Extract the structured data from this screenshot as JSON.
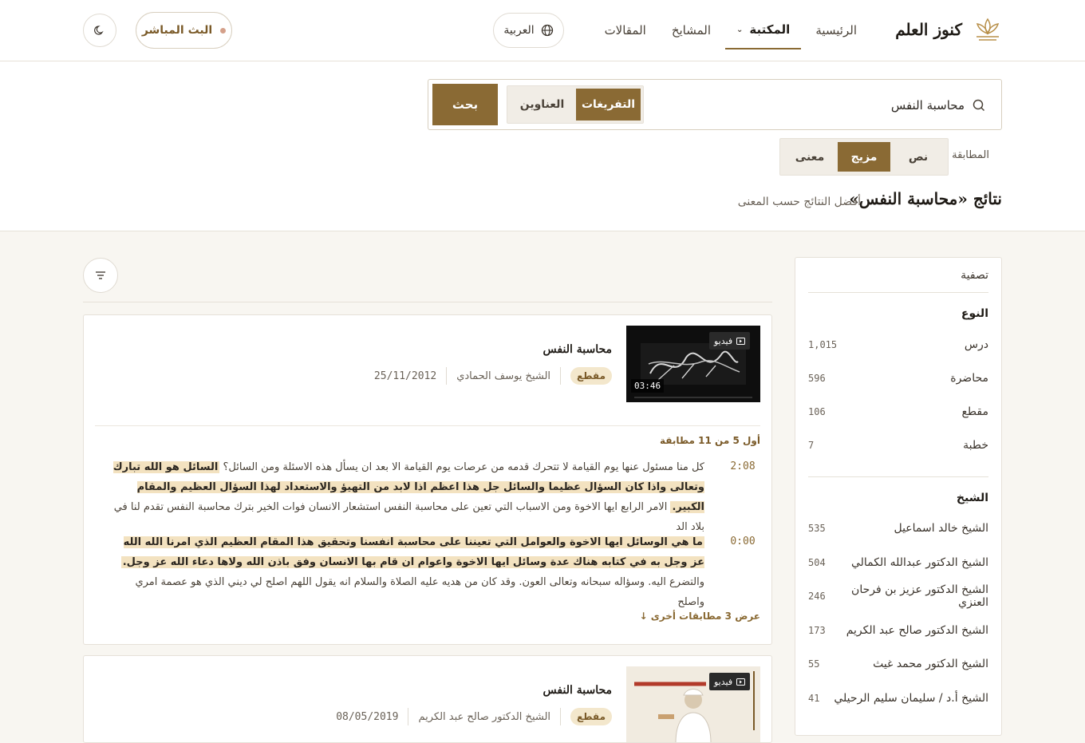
{
  "header": {
    "logo_text": "كنوز العلم",
    "nav": [
      {
        "label": "الرئيسية"
      },
      {
        "label": "المكتبة"
      },
      {
        "label": "المشايخ"
      },
      {
        "label": "المقالات"
      }
    ],
    "language": "العربية",
    "live": "البث المباشر"
  },
  "search": {
    "query": "محاسبة النفس",
    "scope_options": [
      "العناوين",
      "التفريغات"
    ],
    "scope_selected": "التفريغات",
    "button": "بحث",
    "match_label": "المطابقة",
    "match_options": [
      "نص",
      "مزيج",
      "معنى"
    ],
    "match_selected": "مزيج"
  },
  "results": {
    "title": "نتائج «محاسبة النفس»",
    "subtitle": "أفضل النتائج حسب المعنى"
  },
  "sidebar": {
    "title": "تصفية",
    "type_heading": "النوع",
    "types": [
      {
        "label": "درس",
        "count": "1,015"
      },
      {
        "label": "محاضرة",
        "count": "596"
      },
      {
        "label": "مقطع",
        "count": "106"
      },
      {
        "label": "خطبة",
        "count": "7"
      }
    ],
    "sheikh_heading": "الشيخ",
    "sheikhs": [
      {
        "label": "الشيخ خالد اسماعيل",
        "count": "535"
      },
      {
        "label": "الشيخ الدكتور عبدالله الكمالي",
        "count": "504"
      },
      {
        "label": "الشيخ الدكتور عزيز بن فرحان العنزي",
        "count": "246"
      },
      {
        "label": "الشيخ الدكتور صالح عبد الكريم",
        "count": "173"
      },
      {
        "label": "الشيخ الدكتور محمد غيث",
        "count": "55"
      },
      {
        "label": "الشيخ أ.د / سليمان سليم الرحيلي",
        "count": "41"
      }
    ]
  },
  "cards": [
    {
      "badge": "فيديو",
      "duration": "03:46",
      "title": "محاسبة النفس",
      "tag": "مقطع",
      "sheikh": "الشيخ يوسف الحمادي",
      "date": "25/11/2012",
      "match_count": "أول 5 من 11 مطابقة",
      "snippets": [
        {
          "time": "2:08",
          "parts": [
            {
              "t": "كل منا مسئول عنها يوم القيامة لا تتحرك قدمه من عرصات يوم القيامة الا بعد ان يسأل هذه الاسئلة ومن السائل؟ ",
              "hl": false
            },
            {
              "t": "السائل هو الله تبارك وتعالى واذا كان السؤال عظيما والسائل جل هذا اعظم اذا لابد من التهيؤ والاستعداد لهذا السؤال العظيم والمقام الكبير.",
              "hl": true
            },
            {
              "t": " الامر الرابع ايها الاخوة ومن الاسباب التي تعين على محاسبة النفس استشعار الانسان فوات الخير بترك محاسبة النفس تقدم لنا في بلاد الد",
              "hl": false
            }
          ]
        },
        {
          "time": "0:00",
          "parts": [
            {
              "t": "ما هي الوسائل ايها الاخوة والعوامل التي تعيننا على محاسبة انفسنا وتحقيق هذا المقام العظيم الذي امرنا الله الله عز وجل به في كتابه هناك عدة وسائل ايها الاخوة واعوام ان قام بها الانسان وفق باذن الله ولاها دعاء الله عز وجل.",
              "hl": true
            },
            {
              "t": " والتضرع اليه. وسؤاله سبحانه وتعالى العون. وقد كان من هديه عليه الصلاة والسلام انه يقول اللهم اصلح لي ديني الذي هو عصمة امري واصلح",
              "hl": false
            }
          ]
        }
      ],
      "more": "عرض 3 مطابقات أخرى ↓"
    },
    {
      "badge": "فيديو",
      "title": "محاسبة النفس",
      "tag": "مقطع",
      "sheikh": "الشيخ الدكتور صالح عبد الكريم",
      "date": "08/05/2019"
    }
  ]
}
